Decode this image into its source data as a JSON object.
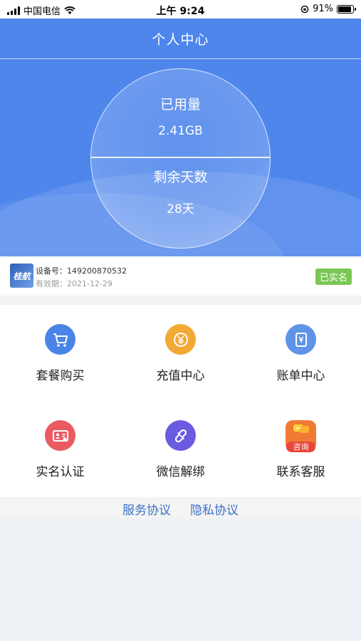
{
  "status_bar": {
    "carrier": "中国电信",
    "time": "上午 9:24",
    "battery": "91%",
    "battery_level": 0.91
  },
  "header": {
    "title": "个人中心"
  },
  "usage": {
    "used_label": "已用量",
    "used_value": "2.41GB",
    "remaining_label": "剩余天数",
    "remaining_value": "28天"
  },
  "device": {
    "logo_text": "桂航",
    "id_label": "设备号：",
    "id_value": "149200870532",
    "expiry_label": "有效期：",
    "expiry_value": "2021-12-29",
    "status_badge": "已实名"
  },
  "menu": [
    {
      "label": "套餐购买",
      "icon": "cart-icon",
      "color": "#4a84e6"
    },
    {
      "label": "充值中心",
      "icon": "yen-coin-icon",
      "color": "#f2a935"
    },
    {
      "label": "账单中心",
      "icon": "bill-icon",
      "color": "#5f93e8"
    },
    {
      "label": "实名认证",
      "icon": "id-card-icon",
      "color": "#ea5a61"
    },
    {
      "label": "微信解绑",
      "icon": "unlink-icon",
      "color": "#6b5be0"
    },
    {
      "label": "联系客服",
      "icon": "consult-icon",
      "color": "#f07a34",
      "badge": "咨询"
    }
  ],
  "footer_links": {
    "service": "服务协议",
    "privacy": "隐私协议"
  }
}
